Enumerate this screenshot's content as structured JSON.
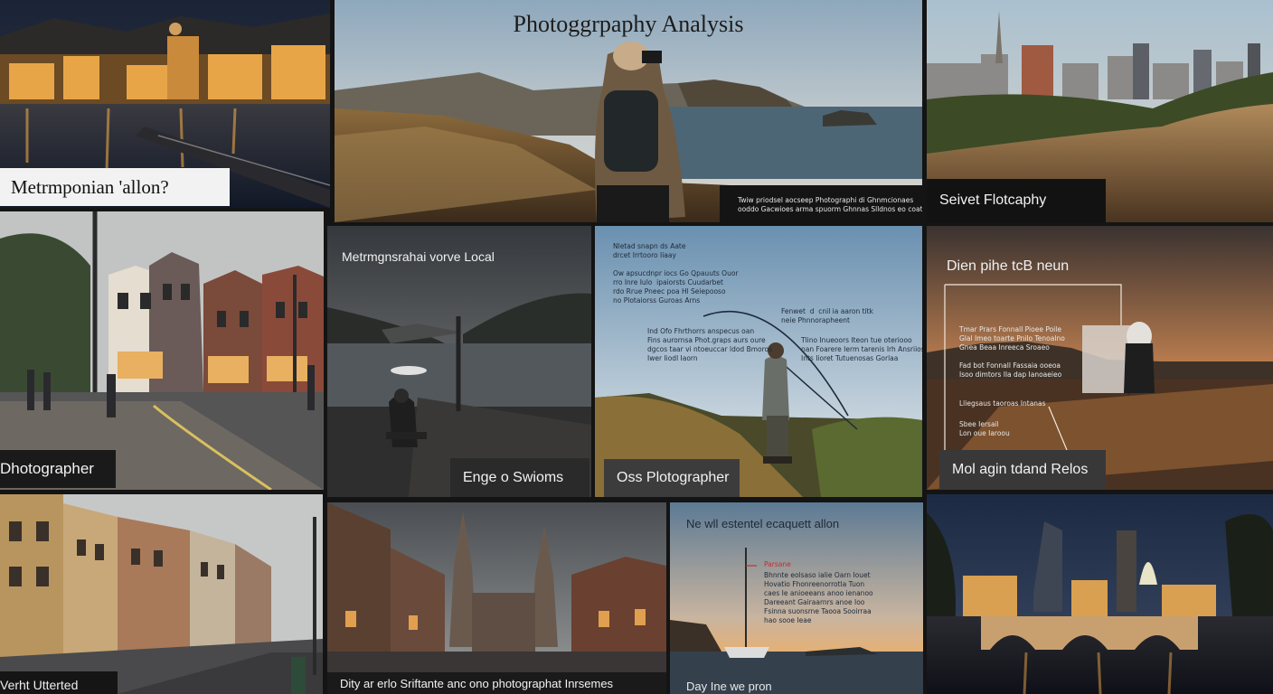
{
  "title": "Photoggrpaphy Analysis",
  "tiles": {
    "t1": {
      "label": "Metrmponian 'allon?"
    },
    "t2": {
      "caption": "Twiw priodsel aocseep Photographi di Ghnmcionaes\nooddo Gacwioes arma spuorm Ghnnas Slldnos eo coatk"
    },
    "t3": {
      "label": "Seivet Flotcaphy"
    },
    "t4": {
      "label": "Dhotographer"
    },
    "t5": {
      "heading": "Metrmgnsrahai vorve Local",
      "label": "Enge o Swioms"
    },
    "t6": {
      "note1": "Nletad snapn ds Aate\ndrcet Irrtooro Iiaay",
      "note2": "Ow apsucdnpr iocs Go Qpauuts Ouor\nrro Inre Iulo  ipaiorsts Cuudarbet\nrdo Rrue Pneec poa Hl Seiepooso\nno Plotaiorss Guroas Arns",
      "note3": "Fenwet  d  cnil ia aaron titk\nneie Phnnorapheent",
      "note4": "Ind Ofo Fhrthorrs anspecus oan\nFins aurornsa Phot.graps aurs oure\ndgcos taar vi ntoeuccar ldod Bmoros\nIwer Iiodl Iaorn",
      "note5": "Tlino Inueoors Iteon tue oteriooo\nnan Foarere Ierm tarenis Irh Ansriios\nInts Iioret Tutuenosas Gorlaa",
      "label": "Oss Plotographer"
    },
    "t7": {
      "heading": "Dien pihe tcB neun",
      "note1": "Tmar Prars Fonnall Pioee Poile\nGlal Imeo toarte Pnilo Tenoalno\nGnea Beaa Inreeca Sroaeo",
      "note2": "Fad bot Fonnall Fassaia ooeoa\nIsoo dimtors Ila dap Ianoaeieo",
      "note3": "Lliegsaus taoroas Intanas",
      "note4": "Sbee Iersail\nLon oue Iaroou",
      "label": "Mol agin tdand Relos"
    },
    "t8": {
      "label": "Verht Utterted"
    },
    "t9": {
      "caption": "Dity ar erlo Sriftante anc ono photographat Inrsemes"
    },
    "t10": {
      "heading": "Ne wll estentel ecaquett allon",
      "note1": "Parsane",
      "note2": "Bhnnte eolsaso ialie Oarn Iouet\nHovatio Fhonreenorrotla Tuon\ncaes Ie anioeeans anoo ienanoo\nDareeant Gairaarnrs anoe Ioo\nFsinna suonsrne Taooa Sooirraa\nhao sooe Ieae",
      "caption": "Day Ine we pron"
    },
    "t11": {}
  }
}
